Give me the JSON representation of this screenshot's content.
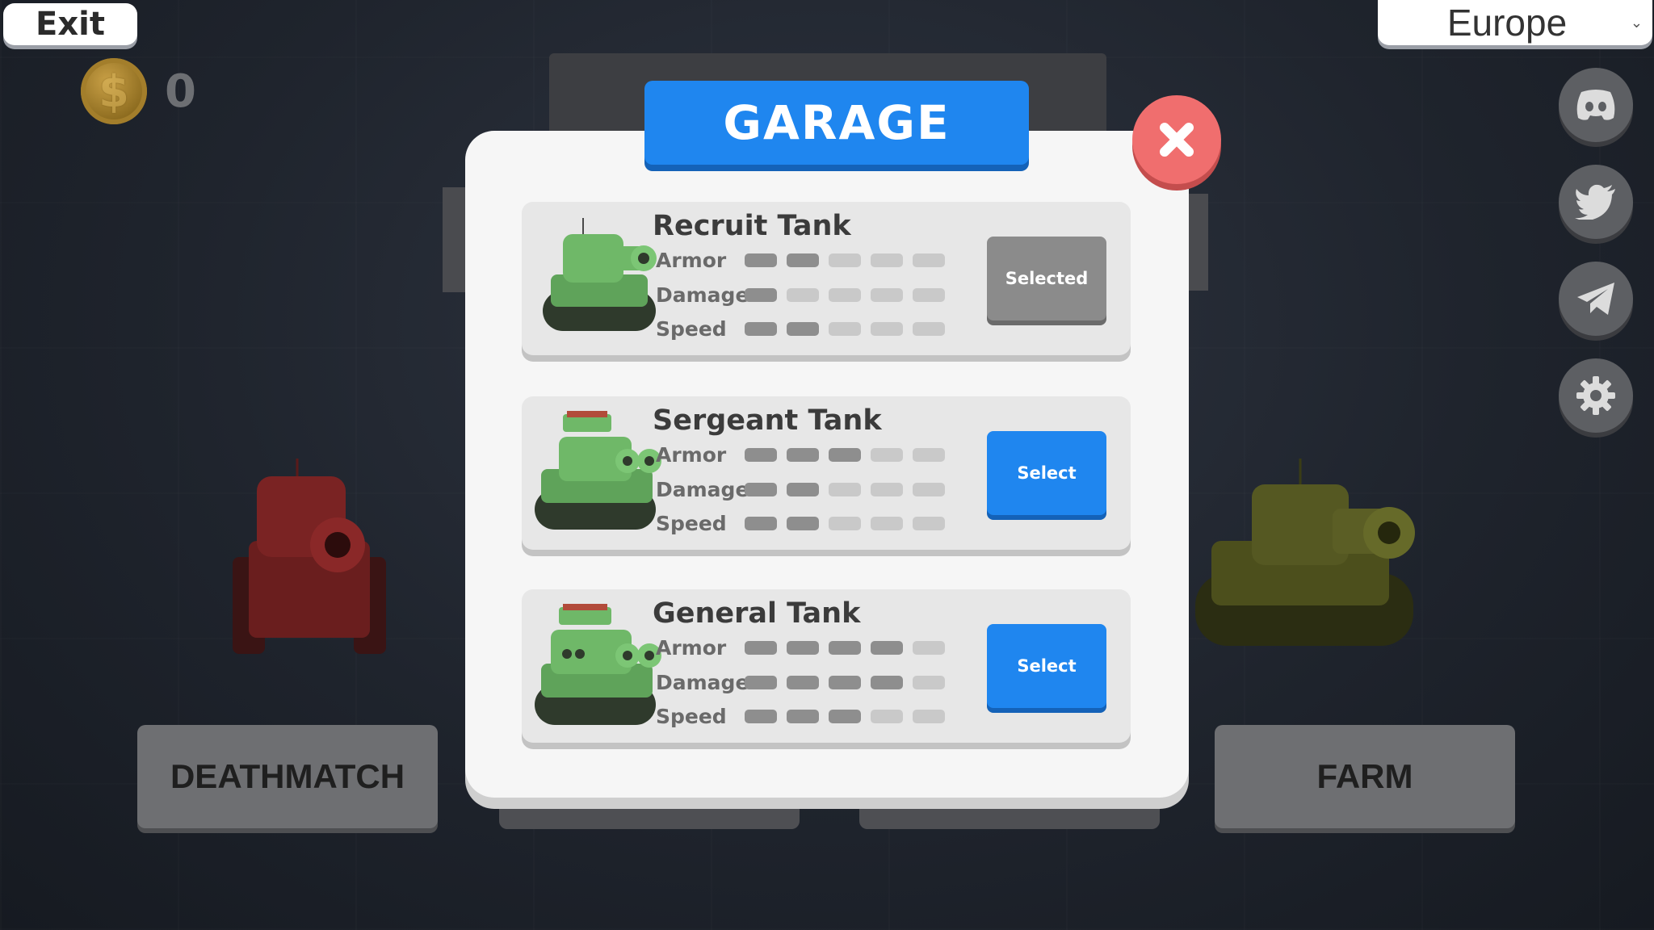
{
  "top_left": {
    "exit_label": "Exit",
    "coin_symbol": "$",
    "coin_count": "0"
  },
  "region": {
    "label": "Europe"
  },
  "social": [
    {
      "name": "discord-icon"
    },
    {
      "name": "twitter-icon"
    },
    {
      "name": "telegram-icon"
    },
    {
      "name": "gear-icon"
    }
  ],
  "modes": {
    "left": "DEATHMATCH",
    "right": "FARM"
  },
  "garage": {
    "title": "GARAGE",
    "stat_labels": {
      "armor": "Armor",
      "damage": "Damage",
      "speed": "Speed"
    },
    "tanks": [
      {
        "name": "Recruit Tank",
        "armor": 2,
        "damage": 1,
        "speed": 2,
        "button": "Selected",
        "selected": true
      },
      {
        "name": "Sergeant Tank",
        "armor": 3,
        "damage": 2,
        "speed": 2,
        "button": "Select",
        "selected": false
      },
      {
        "name": "General Tank",
        "armor": 4,
        "damage": 4,
        "speed": 3,
        "button": "Select",
        "selected": false
      }
    ],
    "max_level": 5
  },
  "colors": {
    "accent_blue": "#1f86ef",
    "close_red": "#f06e6e",
    "pip_on": "#8e8e8e",
    "pip_off": "#c9c9c9"
  }
}
